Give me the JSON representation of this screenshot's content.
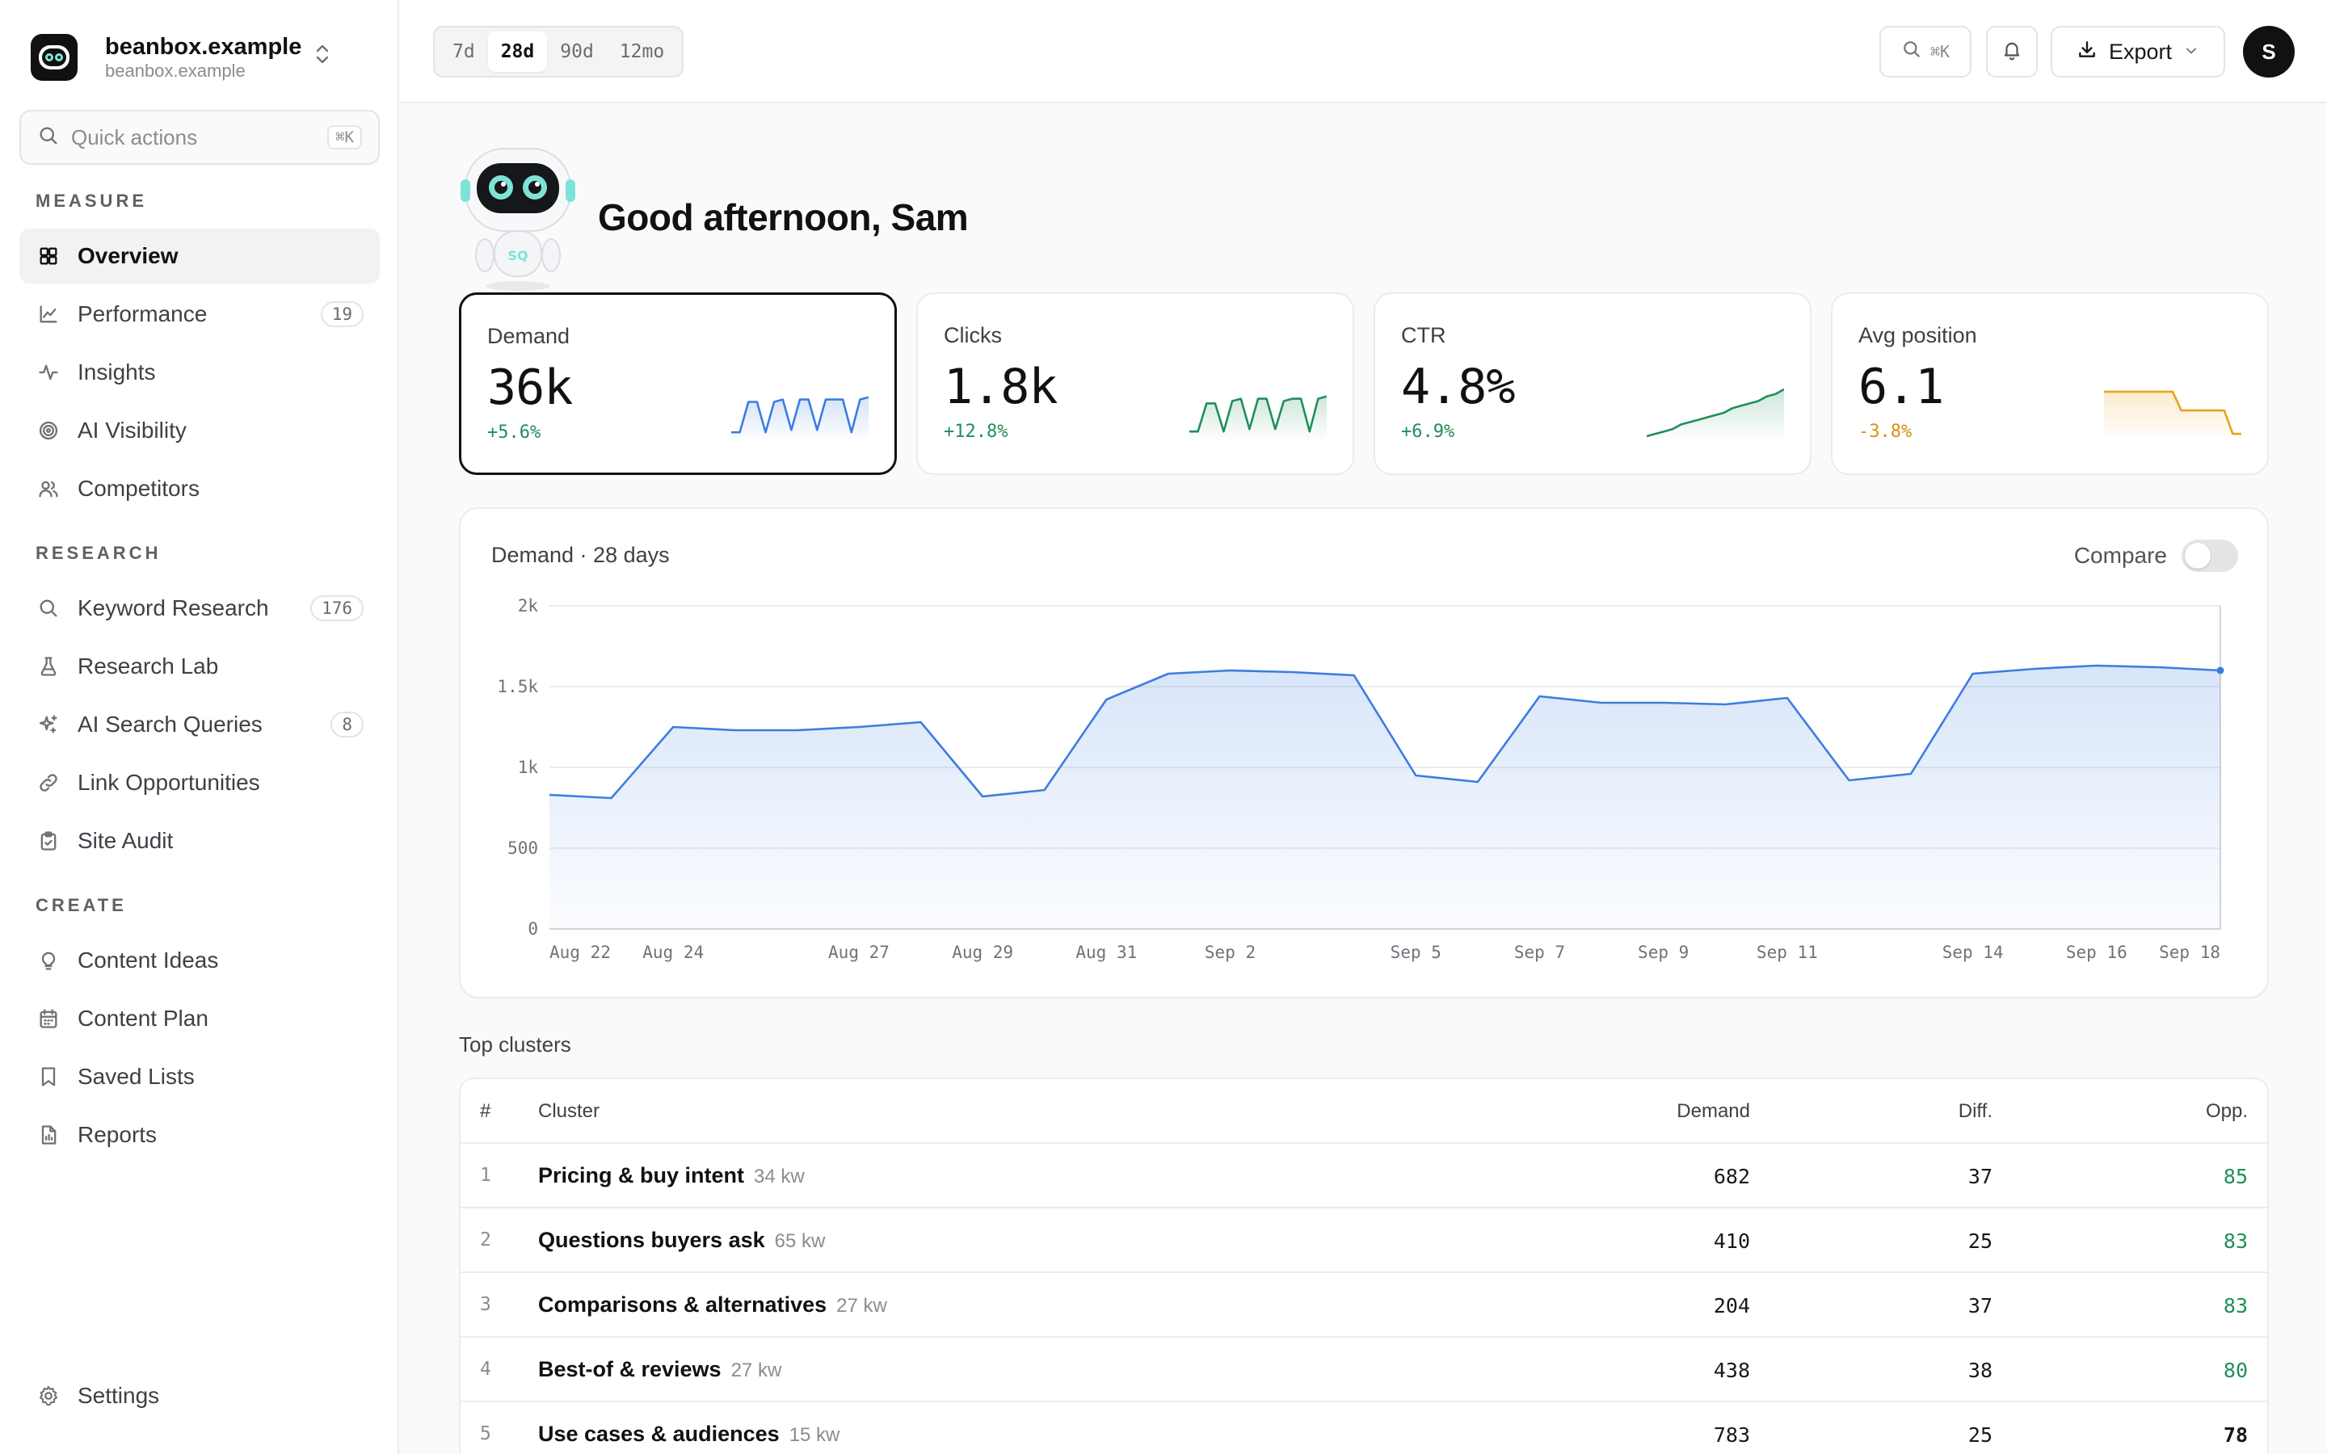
{
  "workspace": {
    "name": "beanbox.example",
    "domain": "beanbox.example"
  },
  "quick_actions": {
    "placeholder": "Quick actions",
    "shortcut": "⌘K"
  },
  "sidebar": {
    "sections": [
      {
        "label": "MEASURE",
        "items": [
          {
            "label": "Overview",
            "icon": "grid-icon",
            "active": true
          },
          {
            "label": "Performance",
            "icon": "line-chart-icon",
            "badge": "19"
          },
          {
            "label": "Insights",
            "icon": "pulse-icon"
          },
          {
            "label": "AI Visibility",
            "icon": "target-icon"
          },
          {
            "label": "Competitors",
            "icon": "users-icon"
          }
        ]
      },
      {
        "label": "RESEARCH",
        "items": [
          {
            "label": "Keyword Research",
            "icon": "search-icon",
            "badge": "176"
          },
          {
            "label": "Research Lab",
            "icon": "flask-icon"
          },
          {
            "label": "AI Search Queries",
            "icon": "sparkles-icon",
            "badge": "8"
          },
          {
            "label": "Link Opportunities",
            "icon": "link-icon"
          },
          {
            "label": "Site Audit",
            "icon": "clipboard-icon"
          }
        ]
      },
      {
        "label": "CREATE",
        "items": [
          {
            "label": "Content Ideas",
            "icon": "lightbulb-icon"
          },
          {
            "label": "Content Plan",
            "icon": "calendar-icon"
          },
          {
            "label": "Saved Lists",
            "icon": "bookmark-icon"
          },
          {
            "label": "Reports",
            "icon": "report-icon"
          }
        ]
      }
    ],
    "settings_label": "Settings"
  },
  "topbar": {
    "ranges": [
      "7d",
      "28d",
      "90d",
      "12mo"
    ],
    "active_range": "28d",
    "search_shortcut": "⌘K",
    "export_label": "Export",
    "avatar_initial": "S"
  },
  "greeting": "Good afternoon, Sam",
  "mascot_text": "SQ",
  "kpis": [
    {
      "label": "Demand",
      "value": "36k",
      "delta": "+5.6%",
      "color": "#3b7de0",
      "selected": true
    },
    {
      "label": "Clicks",
      "value": "1.8k",
      "delta": "+12.8%",
      "color": "#1f8f5a"
    },
    {
      "label": "CTR",
      "value": "4.8%",
      "delta": "+6.9%",
      "color": "#1f8f5a"
    },
    {
      "label": "Avg position",
      "value": "6.1",
      "delta": "-3.8%",
      "color": "#e8a317"
    }
  ],
  "colors": {
    "accent": "#3b7de0",
    "positive": "#1f8f5a",
    "negative": "#d9920b"
  },
  "chart_title": "Demand · 28 days",
  "compare_label": "Compare",
  "compare_on": false,
  "chart_data": {
    "type": "area",
    "ylim": [
      0,
      2000
    ],
    "yticks": [
      0,
      500,
      1000,
      1500,
      2000
    ],
    "ytick_labels": [
      "0",
      "500",
      "1k",
      "1.5k",
      "2k"
    ],
    "x": [
      "Aug 22",
      "Aug 23",
      "Aug 24",
      "Aug 25",
      "Aug 26",
      "Aug 27",
      "Aug 28",
      "Aug 29",
      "Aug 30",
      "Aug 31",
      "Sep 1",
      "Sep 2",
      "Sep 3",
      "Sep 4",
      "Sep 5",
      "Sep 6",
      "Sep 7",
      "Sep 8",
      "Sep 9",
      "Sep 10",
      "Sep 11",
      "Sep 12",
      "Sep 13",
      "Sep 14",
      "Sep 15",
      "Sep 16",
      "Sep 17",
      "Sep 18"
    ],
    "xtick_labels": [
      "Aug 22",
      "Aug 24",
      "Aug 27",
      "Aug 29",
      "Aug 31",
      "Sep 2",
      "Sep 5",
      "Sep 7",
      "Sep 9",
      "Sep 11",
      "Sep 14",
      "Sep 16",
      "Sep 18"
    ],
    "series": [
      {
        "values": [
          830,
          810,
          1250,
          1230,
          1230,
          1250,
          1280,
          820,
          860,
          1420,
          1580,
          1600,
          1590,
          1570,
          950,
          910,
          1440,
          1400,
          1400,
          1390,
          1430,
          920,
          960,
          1580,
          1610,
          1630,
          1620,
          1600
        ]
      }
    ],
    "grid": true
  },
  "clusters_title": "Top clusters",
  "table": {
    "headers": {
      "rank": "#",
      "cluster": "Cluster",
      "demand": "Demand",
      "diff": "Diff.",
      "opp": "Opp."
    },
    "rows": [
      {
        "rank": "1",
        "name": "Pricing & buy intent",
        "kw": "34 kw",
        "demand": "682",
        "diff": "37",
        "opp": "85",
        "opp_color": "#1f8f5a"
      },
      {
        "rank": "2",
        "name": "Questions buyers ask",
        "kw": "65 kw",
        "demand": "410",
        "diff": "25",
        "opp": "83",
        "opp_color": "#1f8f5a"
      },
      {
        "rank": "3",
        "name": "Comparisons & alternatives",
        "kw": "27 kw",
        "demand": "204",
        "diff": "37",
        "opp": "83",
        "opp_color": "#1f8f5a"
      },
      {
        "rank": "4",
        "name": "Best-of & reviews",
        "kw": "27 kw",
        "demand": "438",
        "diff": "38",
        "opp": "80",
        "opp_color": "#1f8f5a"
      },
      {
        "rank": "5",
        "name": "Use cases & audiences",
        "kw": "15 kw",
        "demand": "783",
        "diff": "25",
        "opp": "78",
        "opp_color": "#18181b"
      }
    ]
  }
}
